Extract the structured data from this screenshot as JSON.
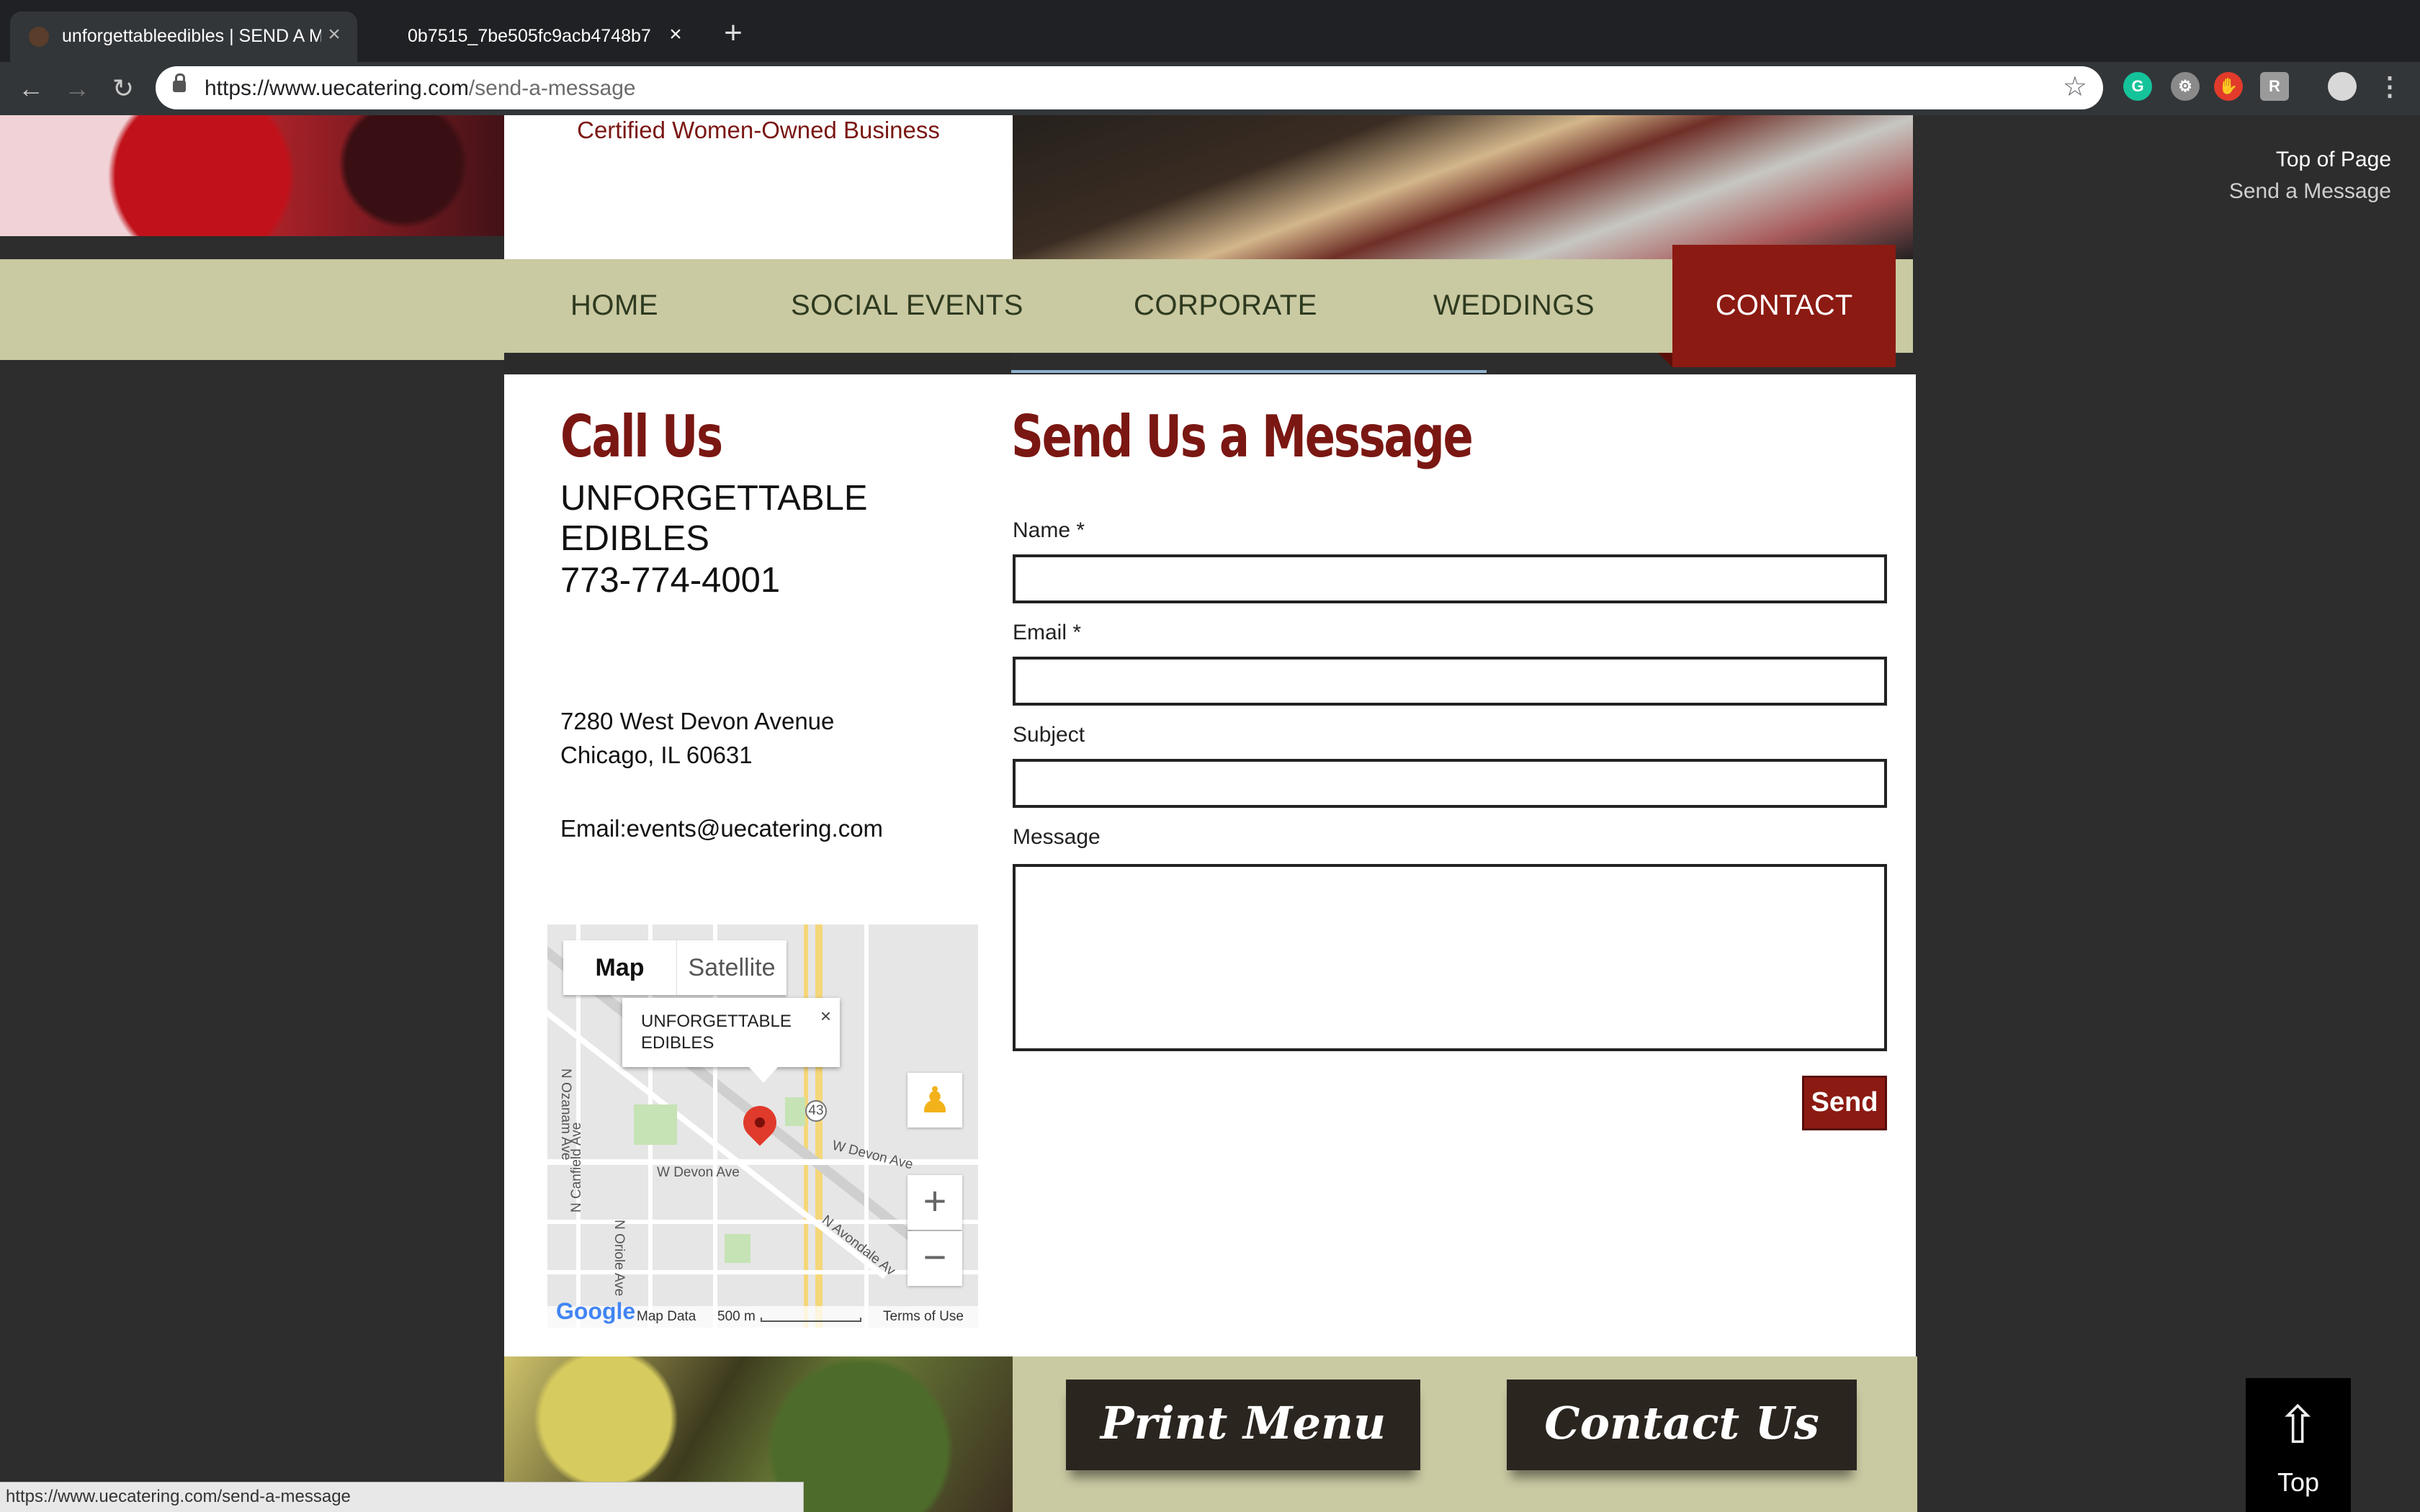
{
  "browser": {
    "tabs": [
      {
        "title": "unforgettableedibles | SEND A MESSAGE"
      },
      {
        "title": "0b7515_7be505fc9acb4748b7"
      }
    ],
    "url_host": "https://www.uecatering.com",
    "url_path": "/send-a-message",
    "status_url": "https://www.uecatering.com/send-a-message"
  },
  "header": {
    "tagline": "Certified Women-Owned Business"
  },
  "nav": {
    "items": [
      "HOME",
      "SOCIAL EVENTS",
      "CORPORATE",
      "WEDDINGS",
      "CONTACT"
    ],
    "active": "CONTACT"
  },
  "call": {
    "heading": "Call Us",
    "company": "UNFORGETTABLE EDIBLES",
    "phone": "773-774-4001",
    "address_line1": "7280 West Devon Avenue",
    "address_line2": "Chicago, IL 60631",
    "email": "Email:events@uecatering.com"
  },
  "map": {
    "tab_map": "Map",
    "tab_satellite": "Satellite",
    "info_title": "UNFORGETTABLE EDIBLES",
    "streets": [
      "W Devon Ave",
      "W Devon Ave",
      "N Oriole Ave",
      "N Ozanam Ave",
      "N Canfield Ave",
      "N Avondale Av",
      "43"
    ],
    "footer_data": "Map Data",
    "footer_scale": "500 m",
    "footer_terms": "Terms of Use",
    "logo": "Google"
  },
  "form": {
    "heading": "Send Us a Message",
    "name_label": "Name *",
    "email_label": "Email *",
    "subject_label": "Subject",
    "message_label": "Message",
    "send_label": "Send"
  },
  "footer": {
    "print_menu": "Print Menu",
    "contact_us": "Contact Us"
  },
  "side": {
    "top_of_page": "Top of Page",
    "send_message": "Send a Message",
    "top_button": "Top"
  },
  "colors": {
    "brand_red": "#7a1713",
    "nav_bg": "#c9c9a2"
  }
}
